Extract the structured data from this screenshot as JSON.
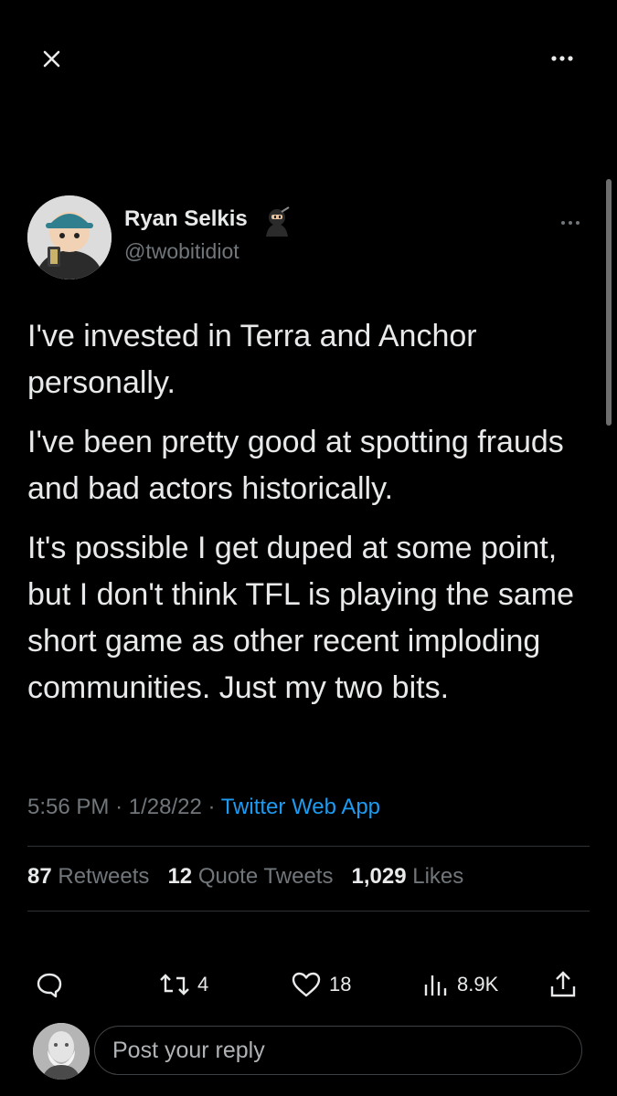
{
  "header": {
    "close_icon": "close-icon",
    "more_icon": "more-horizontal-icon"
  },
  "tweet": {
    "author_name": "Ryan Selkis",
    "author_handle": "@twobitidiot",
    "paragraphs": [
      "I've invested in Terra and Anchor personally.",
      "I've been pretty good at spotting frauds and bad actors historically.",
      "It's possible I get duped at some point, but I don't think TFL is playing the same short game as other recent imploding communities. Just my two bits."
    ],
    "time": "5:56 PM",
    "date": "1/28/22",
    "source": "Twitter Web App"
  },
  "stats": {
    "retweets_count": "87",
    "retweets_label": "Retweets",
    "quotes_count": "12",
    "quotes_label": "Quote Tweets",
    "likes_count": "1,029",
    "likes_label": "Likes"
  },
  "actions": {
    "retweet_count": "4",
    "like_count": "18",
    "views_count": "8.9K"
  },
  "reply": {
    "placeholder": "Post your reply"
  },
  "colors": {
    "background": "#000000",
    "text": "#e7e9ea",
    "muted": "#71767b",
    "link": "#1d9bf0"
  }
}
